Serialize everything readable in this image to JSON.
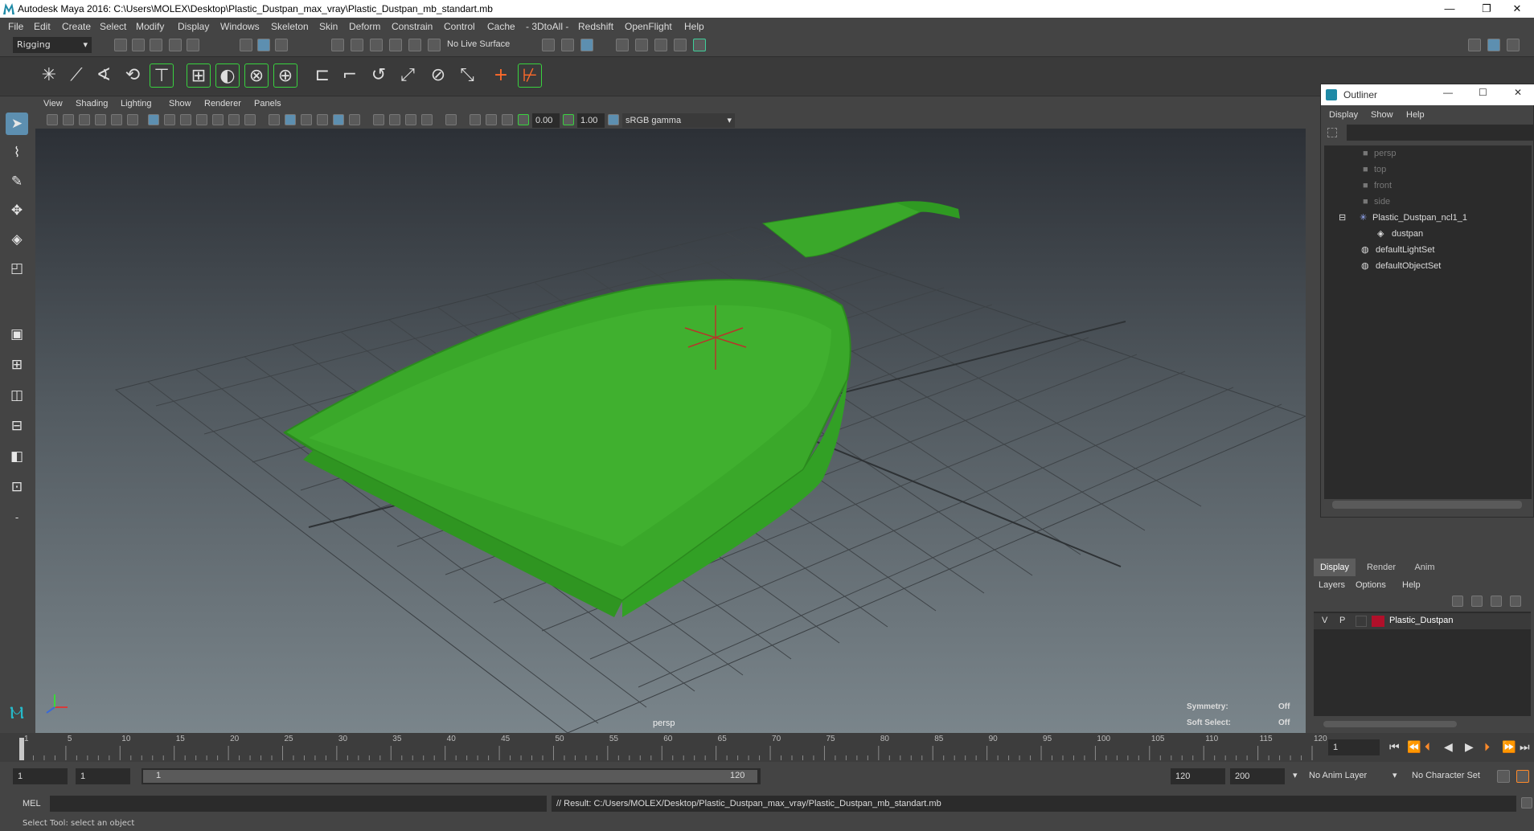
{
  "window": {
    "title": "Autodesk Maya 2016: C:\\Users\\MOLEX\\Desktop\\Plastic_Dustpan_max_vray\\Plastic_Dustpan_mb_standart.mb",
    "minimize": "—",
    "restore": "❐",
    "close": "✕"
  },
  "menubar": [
    "File",
    "Edit",
    "Create",
    "Select",
    "Modify",
    "Display",
    "Windows",
    "Skeleton",
    "Skin",
    "Deform",
    "Constrain",
    "Control",
    "Cache",
    "- 3DtoAll -",
    "Redshift",
    "OpenFlight",
    "Help"
  ],
  "statusline": {
    "menuset": "Rigging",
    "live_surface": "No Live Surface"
  },
  "viewport": {
    "menu": [
      "View",
      "Shading",
      "Lighting",
      "Show",
      "Renderer",
      "Panels"
    ],
    "exposure": "0.00",
    "gamma": "1.00",
    "color_space": "sRGB gamma",
    "camera_label": "persp",
    "symmetry_label": "Symmetry:",
    "symmetry_value": "Off",
    "soft_select_label": "Soft Select:",
    "soft_select_value": "Off",
    "object_color": "#3aa82a"
  },
  "outliner": {
    "title": "Outliner",
    "menu": [
      "Display",
      "Show",
      "Help"
    ],
    "items": [
      {
        "label": "persp",
        "icon": "camera-icon",
        "dim": true
      },
      {
        "label": "top",
        "icon": "camera-icon",
        "dim": true
      },
      {
        "label": "front",
        "icon": "camera-icon",
        "dim": true
      },
      {
        "label": "side",
        "icon": "camera-icon",
        "dim": true
      },
      {
        "label": "Plastic_Dustpan_ncl1_1",
        "icon": "group-icon",
        "dim": false
      },
      {
        "label": "dustpan",
        "icon": "mesh-icon",
        "dim": false
      },
      {
        "label": "defaultLightSet",
        "icon": "set-icon",
        "dim": false
      },
      {
        "label": "defaultObjectSet",
        "icon": "set-icon",
        "dim": false
      }
    ]
  },
  "layers": {
    "tabs": [
      "Display",
      "Render",
      "Anim"
    ],
    "menu": [
      "Layers",
      "Options",
      "Help"
    ],
    "layer": {
      "v": "V",
      "p": "P",
      "name": "Plastic_Dustpan",
      "color": "#b0102a"
    }
  },
  "timeline": {
    "ticks": [
      "1",
      "5",
      "10",
      "15",
      "20",
      "25",
      "30",
      "35",
      "40",
      "45",
      "50",
      "55",
      "60",
      "65",
      "70",
      "75",
      "80",
      "85",
      "90",
      "95",
      "100",
      "105",
      "110",
      "115",
      "120"
    ],
    "current_frame": "1"
  },
  "range": {
    "start": "1",
    "playback_start": "1",
    "slider_start": "1",
    "slider_end": "120",
    "playback_end": "120",
    "end": "200",
    "anim_layer": "No Anim Layer",
    "character_set": "No Character Set"
  },
  "cmdline": {
    "language": "MEL",
    "result": "// Result: C:/Users/MOLEX/Desktop/Plastic_Dustpan_max_vray/Plastic_Dustpan_mb_standart.mb"
  },
  "helpline": "Select Tool: select an object"
}
